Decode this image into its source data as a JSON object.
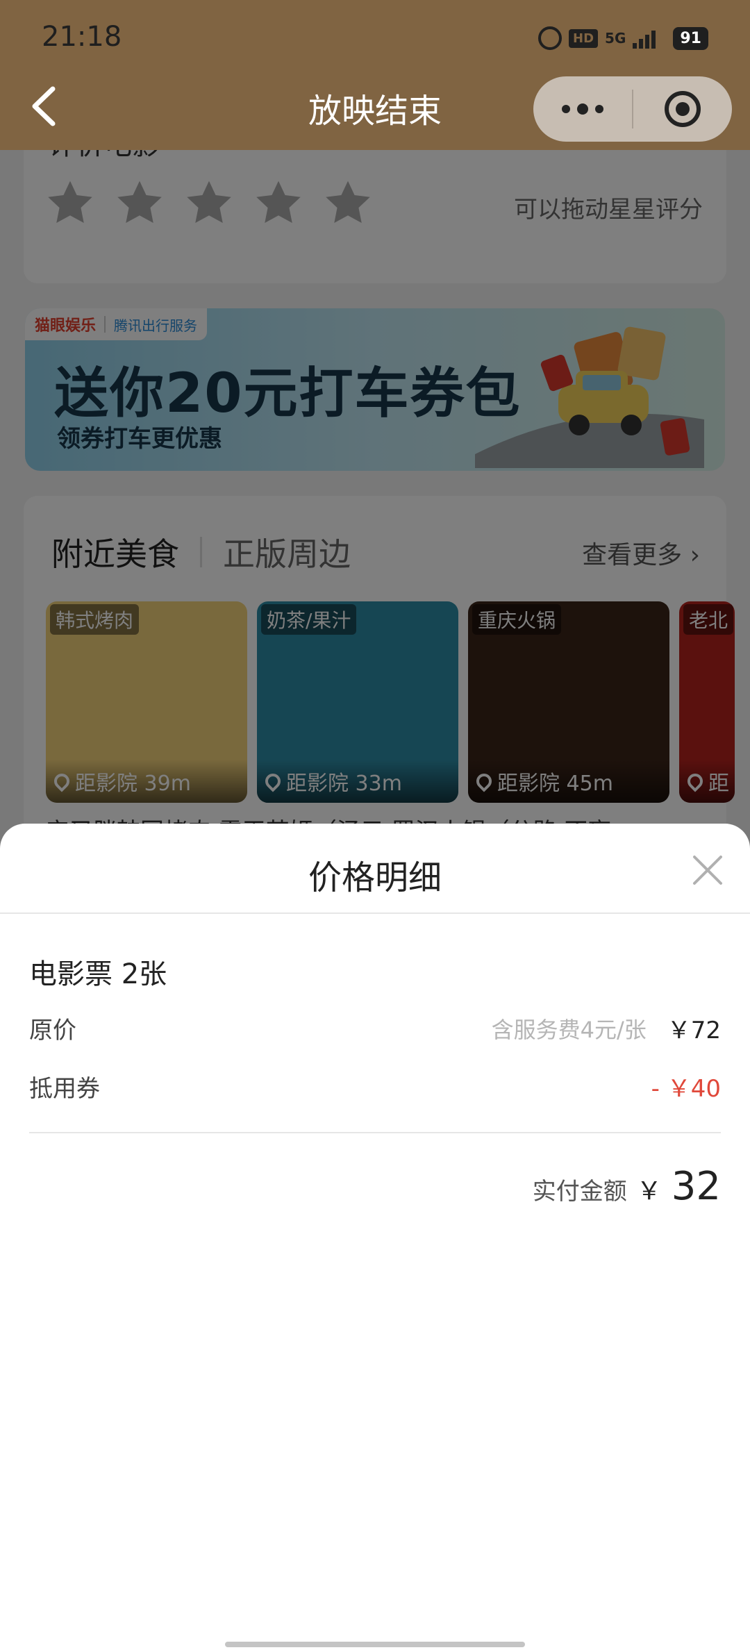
{
  "status_bar": {
    "time": "21:18",
    "hd": "HD",
    "network": "5G",
    "battery": "91"
  },
  "nav": {
    "title": "放映结束",
    "back_icon": "chevron-left-icon",
    "more_icon": "more-dots-icon",
    "close_icon": "target-circle-icon"
  },
  "rating": {
    "label": "评价电影",
    "stars": 5,
    "hint": "可以拖动星星评分"
  },
  "banner": {
    "brand": "猫眼娱乐",
    "partner": "腾讯出行服务",
    "title": "送你20元打车券包",
    "subtitle": "领券打车更优惠"
  },
  "food": {
    "tab_active": "附近美食",
    "tab_other": "正版周边",
    "more": "查看更多 ›",
    "shops": [
      {
        "tag": "韩式烤肉",
        "distance": "距影院 39m",
        "color": "#f3d27a"
      },
      {
        "tag": "奶茶/果汁",
        "distance": "距影院 33m",
        "color": "#2d8ca6"
      },
      {
        "tag": "重庆火锅",
        "distance": "距影院 45m",
        "color": "#3b2418"
      },
      {
        "tag": "老北",
        "distance": "距",
        "color": "#b5221d"
      }
    ],
    "names_row": "安又胖韩国烤肉    霸王茶姬（泾元    蜀汉火锅（分路    不盲"
  },
  "sheet": {
    "title": "价格明细",
    "item": "电影票 2张",
    "original_label": "原价",
    "original_note": "含服务费4元/张",
    "original_value": "￥72",
    "coupon_label": "抵用券",
    "coupon_value": "- ￥40",
    "total_label": "实付金额",
    "total_currency": "￥",
    "total_value": "32"
  }
}
